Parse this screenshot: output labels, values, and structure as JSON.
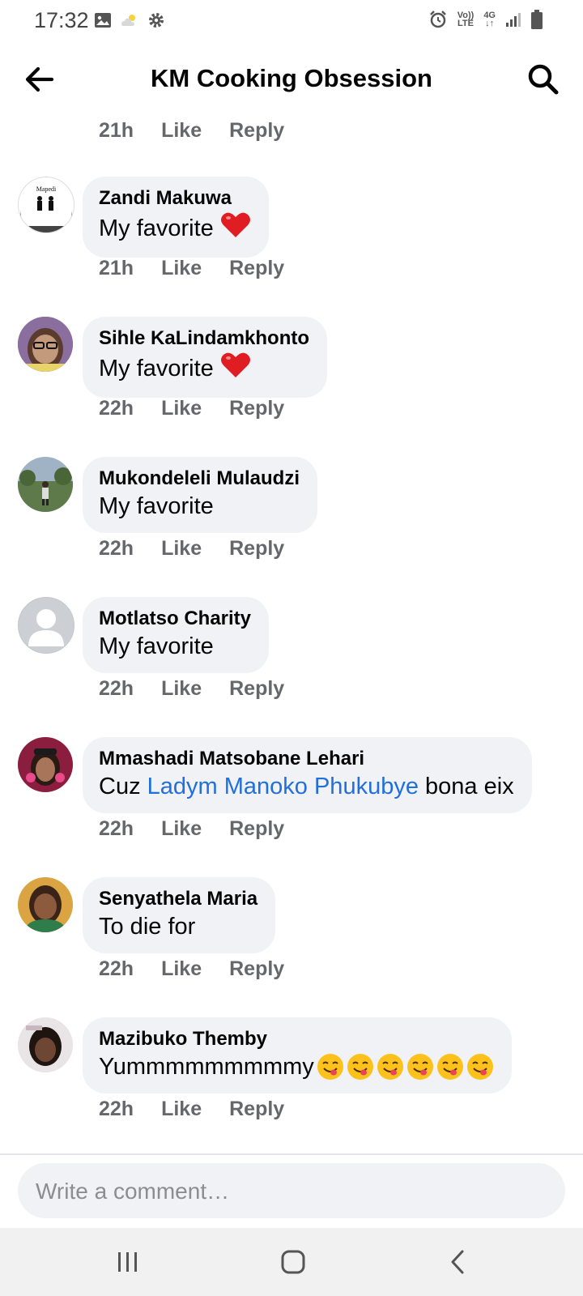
{
  "status_bar": {
    "time": "17:32",
    "volte_top": "Vo))",
    "volte_bottom": "LTE",
    "network": "4G"
  },
  "header": {
    "title": "KM Cooking Obsession"
  },
  "top_meta": {
    "time": "21h",
    "like": "Like",
    "reply": "Reply"
  },
  "comments": [
    {
      "author": "Zandi Makuwa",
      "text": "My favorite",
      "time": "21h",
      "like": "Like",
      "reply": "Reply",
      "avatar_text": [
        "Mapedi",
        "Ke Rena..."
      ]
    },
    {
      "author": "Sihle KaLindamkhonto",
      "text": "My favorite",
      "time": "22h",
      "like": "Like",
      "reply": "Reply"
    },
    {
      "author": "Mukondeleli Mulaudzi",
      "text": "My favorite",
      "time": "22h",
      "like": "Like",
      "reply": "Reply"
    },
    {
      "author": "Motlatso Charity",
      "text": "My favorite",
      "time": "22h",
      "like": "Like",
      "reply": "Reply"
    },
    {
      "author": "Mmashadi Matsobane Lehari",
      "text_prefix": "Cuz ",
      "mention": "Ladym Manoko Phukubye",
      "text_suffix": " bona eix",
      "time": "22h",
      "like": "Like",
      "reply": "Reply"
    },
    {
      "author": "Senyathela Maria",
      "text": "To die for",
      "time": "22h",
      "like": "Like",
      "reply": "Reply"
    },
    {
      "author": "Mazibuko Themby",
      "text": "Yummmmmmmmmy",
      "time": "22h",
      "like": "Like",
      "reply": "Reply"
    }
  ],
  "composer": {
    "placeholder": "Write a comment…"
  },
  "icons": {
    "reaction": "red-heart-icon",
    "emoji": "smiling-face-tongue-icon"
  },
  "colors": {
    "accent_link": "#216fdb",
    "bubble": "#f0f2f5",
    "meta": "#65676b"
  }
}
